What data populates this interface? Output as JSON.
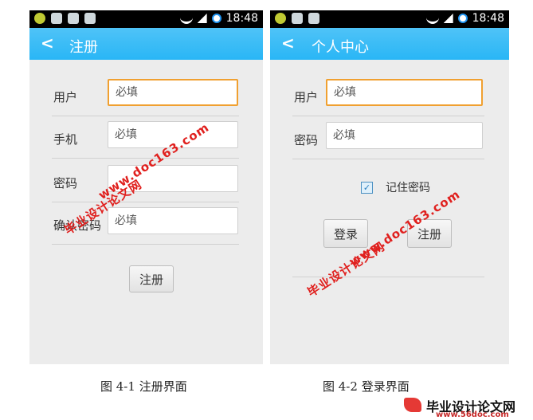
{
  "status_bar": {
    "time": "18:48"
  },
  "register_screen": {
    "title": "注册",
    "fields": [
      {
        "label": "用户",
        "placeholder": "必填"
      },
      {
        "label": "手机",
        "placeholder": "必填"
      },
      {
        "label": "密码",
        "placeholder": ""
      },
      {
        "label": "确认密码",
        "placeholder": "必填"
      }
    ],
    "submit_label": "注册"
  },
  "login_screen": {
    "title": "个人中心",
    "fields": [
      {
        "label": "用户",
        "placeholder": "必填"
      },
      {
        "label": "密码",
        "placeholder": "必填"
      }
    ],
    "remember_label": "记住密码",
    "remember_checked": true,
    "login_label": "登录",
    "register_label": "注册"
  },
  "captions": {
    "left": "图 4-1  注册界面",
    "right": "图 4-2  登录界面"
  },
  "watermarks": {
    "site_name": "毕业设计论文网",
    "url": "www.doc163.com"
  },
  "logo": {
    "name": "毕业设计论文网",
    "url": "www.56doc.com"
  },
  "colors": {
    "titlebar": "#29b6f6",
    "focus_border": "#f0a030",
    "watermark": "#e0201e"
  }
}
